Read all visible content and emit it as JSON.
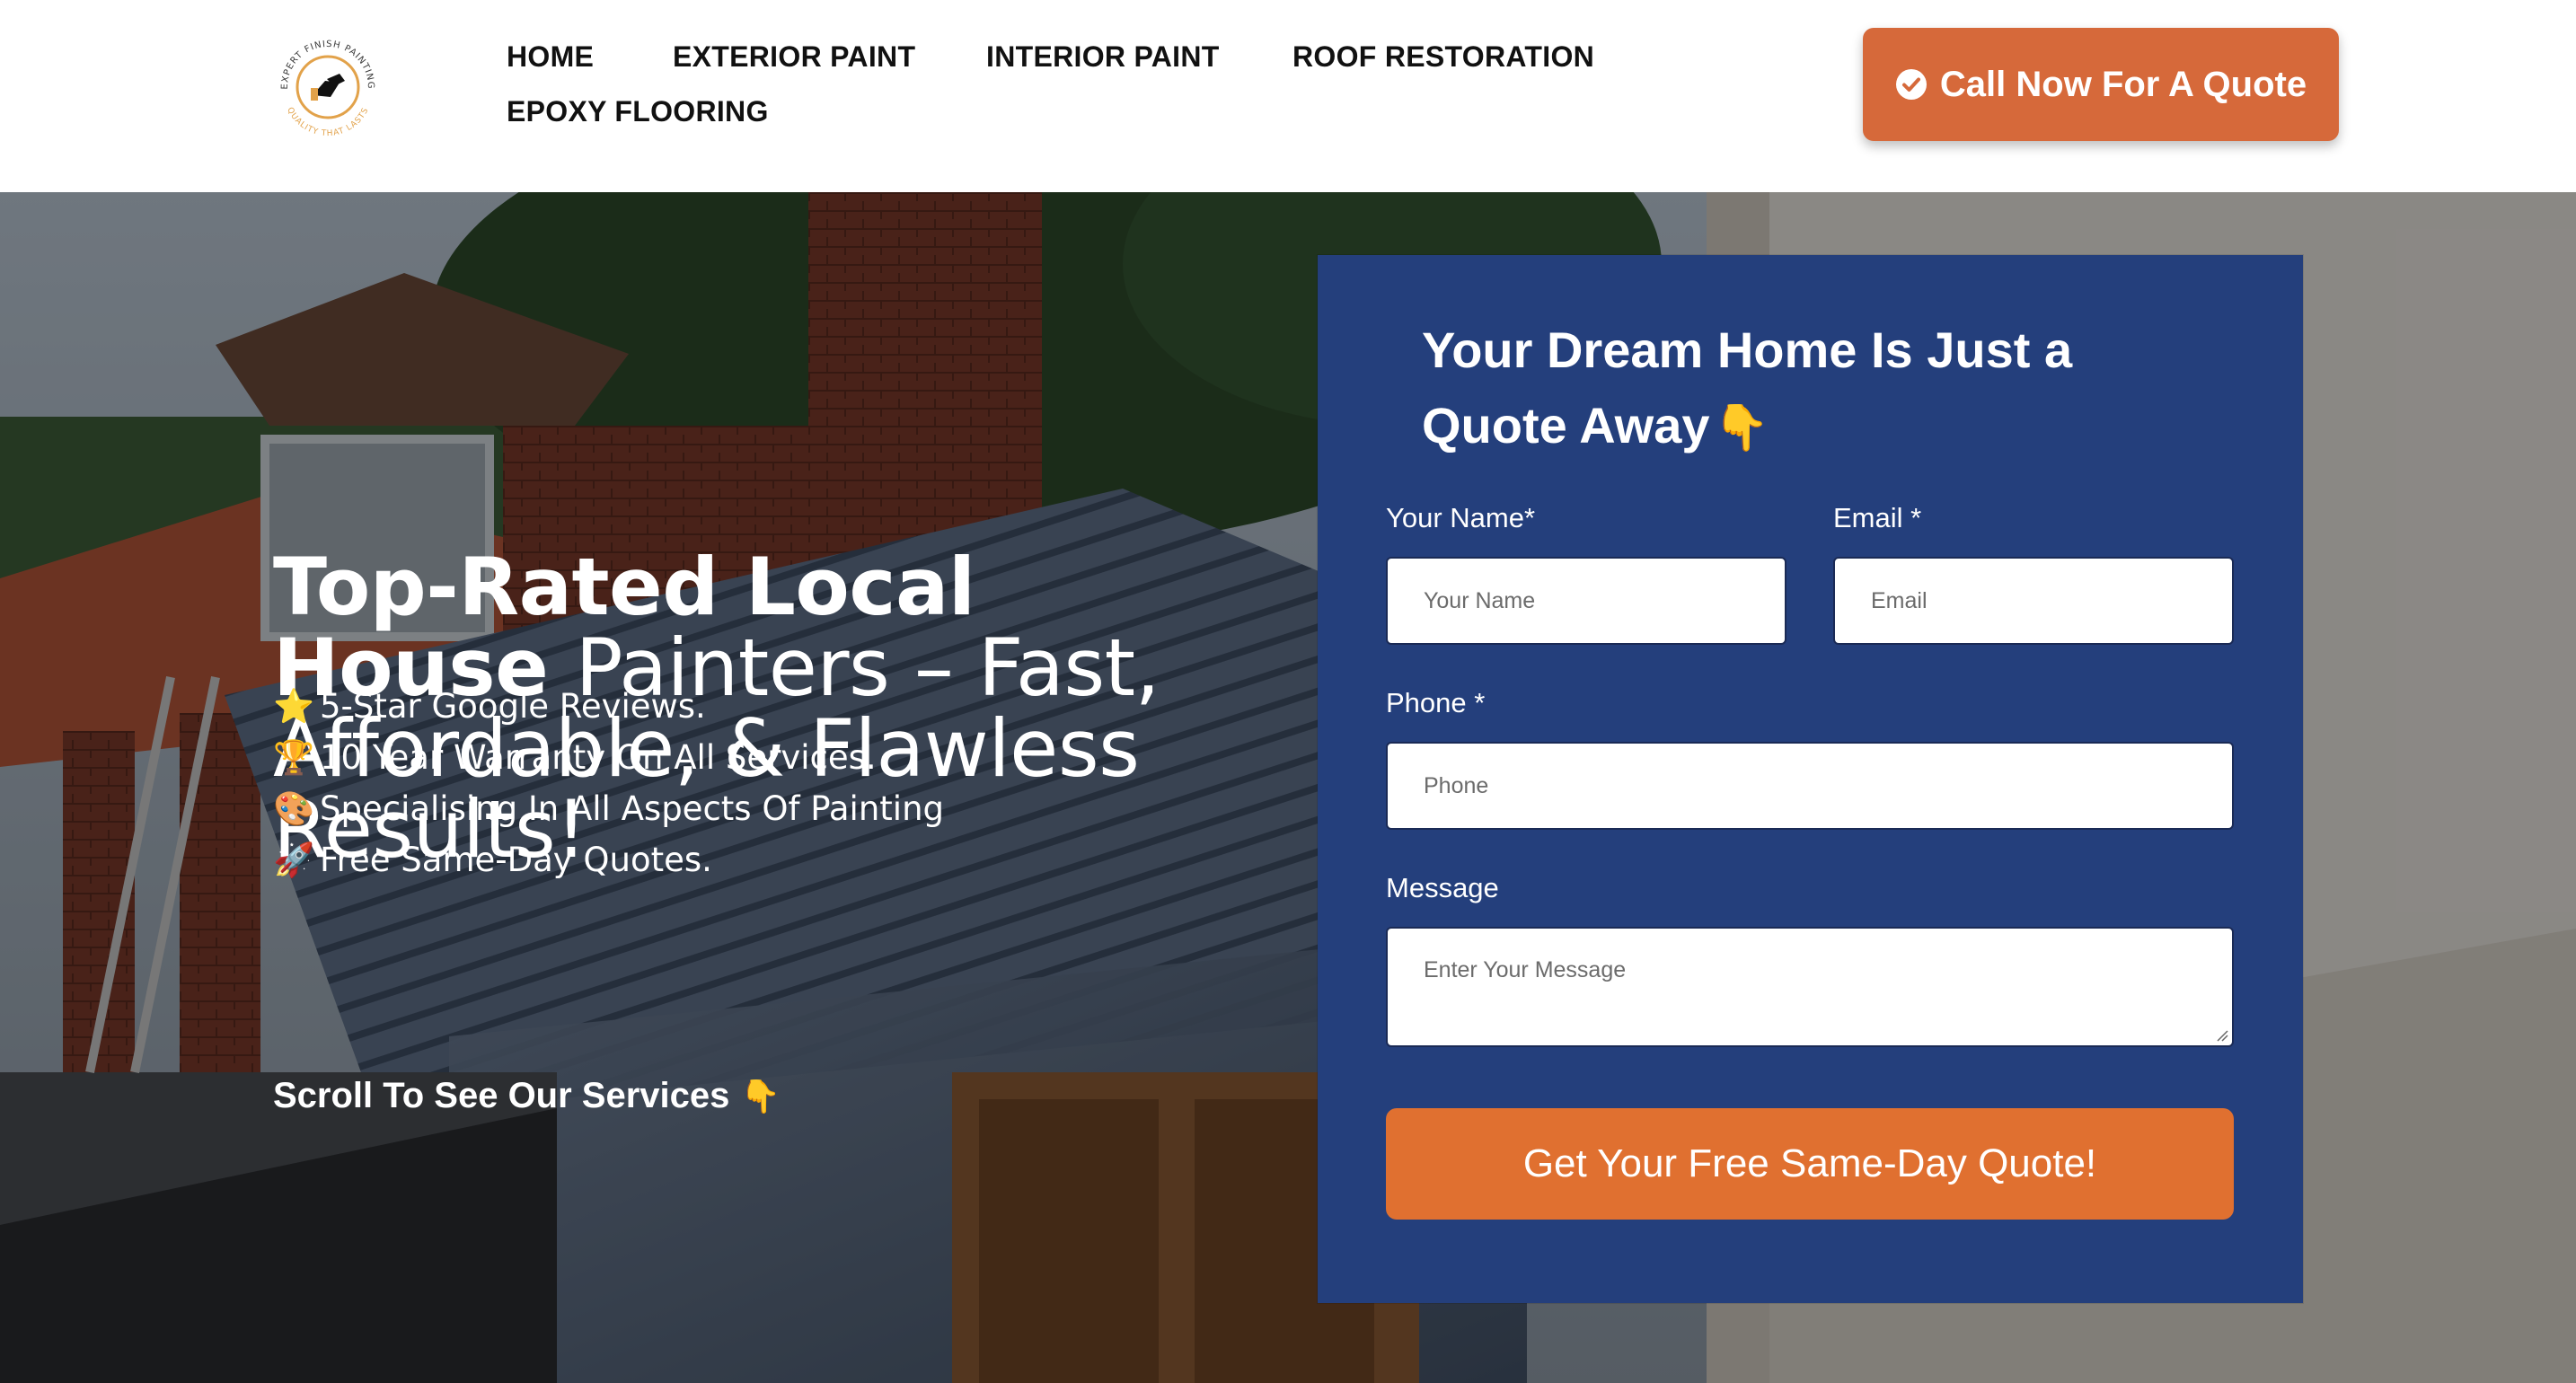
{
  "header": {
    "logo": {
      "icon": "paint-roller-logo-icon",
      "arc_text_top": "EXPERT FINISH PAINTING",
      "arc_text_bottom": "QUALITY THAT LASTS"
    },
    "nav": [
      {
        "label": "HOME"
      },
      {
        "label": "EXTERIOR PAINT"
      },
      {
        "label": "INTERIOR PAINT"
      },
      {
        "label": "ROOF RESTORATION"
      },
      {
        "label": "EPOXY FLOORING"
      }
    ],
    "cta": {
      "label": "Call Now For A Quote",
      "icon": "check-circle-icon"
    }
  },
  "hero": {
    "title_bold": "Top-Rated Local House",
    "title_rest": "Painters – Fast, Affordable, & Flawless Results!",
    "features": [
      {
        "icon": "⭐",
        "icon_name": "star-icon",
        "text": "5-Star Google Reviews."
      },
      {
        "icon": "🏆",
        "icon_name": "trophy-icon",
        "text": "10 Year Warranty On All Services."
      },
      {
        "icon": "🎨",
        "icon_name": "palette-icon",
        "text": "Specialising In All Aspects Of Painting"
      },
      {
        "icon": "🚀",
        "icon_name": "rocket-icon",
        "text": "Free Same-Day Quotes."
      }
    ],
    "scroll_cta": {
      "text": "Scroll To See Our Services",
      "emoji": "👇"
    }
  },
  "form": {
    "heading": "Your Dream Home Is Just a Quote Away",
    "heading_emoji": "👇",
    "name": {
      "label": "Your Name*",
      "placeholder": "Your Name",
      "value": ""
    },
    "email": {
      "label": "Email *",
      "placeholder": "Email",
      "value": ""
    },
    "phone": {
      "label": "Phone *",
      "placeholder": "Phone",
      "value": ""
    },
    "message": {
      "label": "Message",
      "placeholder": "Enter Your Message",
      "value": ""
    },
    "submit": {
      "label": "Get Your Free Same-Day Quote!"
    }
  },
  "colors": {
    "accent_orange": "#d6693a",
    "submit_orange": "#e07030",
    "form_navy": "#243f7c",
    "nav_text": "#111111",
    "white": "#ffffff"
  }
}
